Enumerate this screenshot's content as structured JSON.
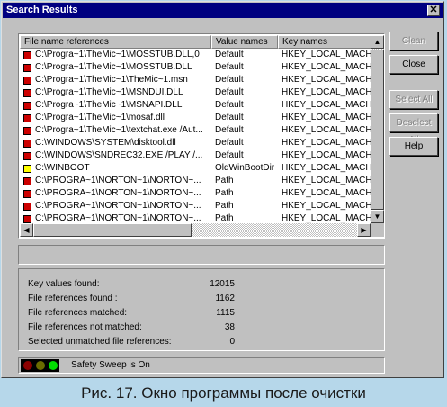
{
  "window": {
    "title": "Search Results",
    "close_glyph": "✕"
  },
  "list": {
    "columns": [
      "File name references",
      "Value names",
      "Key names"
    ],
    "rows": [
      {
        "file": "C:\\Progra~1\\TheMic~1\\MOSSTUB.DLL,0",
        "value": "Default",
        "key": "HKEY_LOCAL_MACHIN",
        "color": "#cc0000"
      },
      {
        "file": "C:\\Progra~1\\TheMic~1\\MOSSTUB.DLL",
        "value": "Default",
        "key": "HKEY_LOCAL_MACHIN",
        "color": "#cc0000"
      },
      {
        "file": "C:\\Progra~1\\TheMic~1\\TheMic~1.msn",
        "value": "Default",
        "key": "HKEY_LOCAL_MACHIN",
        "color": "#cc0000"
      },
      {
        "file": "C:\\Progra~1\\TheMic~1\\MSNDUI.DLL",
        "value": "Default",
        "key": "HKEY_LOCAL_MACHIN",
        "color": "#cc0000"
      },
      {
        "file": "C:\\Progra~1\\TheMic~1\\MSNAPI.DLL",
        "value": "Default",
        "key": "HKEY_LOCAL_MACHIN",
        "color": "#cc0000"
      },
      {
        "file": "C:\\Progra~1\\TheMic~1\\mosaf.dll",
        "value": "Default",
        "key": "HKEY_LOCAL_MACHIN",
        "color": "#cc0000"
      },
      {
        "file": "C:\\Progra~1\\TheMic~1\\textchat.exe /Aut...",
        "value": "Default",
        "key": "HKEY_LOCAL_MACHIN",
        "color": "#cc0000"
      },
      {
        "file": "C:\\WINDOWS\\SYSTEM\\disktool.dll",
        "value": "Default",
        "key": "HKEY_LOCAL_MACHIN",
        "color": "#cc0000"
      },
      {
        "file": "C:\\WINDOWS\\SNDREC32.EXE /PLAY /...",
        "value": "Default",
        "key": "HKEY_LOCAL_MACHIN",
        "color": "#cc0000"
      },
      {
        "file": "C:\\WINBOOT",
        "value": "OldWinBootDir",
        "key": "HKEY_LOCAL_MACHIN",
        "color": "#ffff00"
      },
      {
        "file": "C:\\PROGRA~1\\NORTON~1\\NORTON~...",
        "value": "Path",
        "key": "HKEY_LOCAL_MACHIN",
        "color": "#cc0000"
      },
      {
        "file": "C:\\PROGRA~1\\NORTON~1\\NORTON~...",
        "value": "Path",
        "key": "HKEY_LOCAL_MACHIN",
        "color": "#cc0000"
      },
      {
        "file": "C:\\PROGRA~1\\NORTON~1\\NORTON~...",
        "value": "Path",
        "key": "HKEY_LOCAL_MACHIN",
        "color": "#cc0000"
      },
      {
        "file": "C:\\PROGRA~1\\NORTON~1\\NORTON~...",
        "value": "Path",
        "key": "HKEY_LOCAL_MACHIN",
        "color": "#cc0000"
      }
    ]
  },
  "buttons": {
    "clean": "Clean",
    "close": "Close",
    "select_all": "Select All",
    "deselect_all": "Deselect All",
    "help": "Help"
  },
  "stats": [
    {
      "label": "Key values found:",
      "value": "12015"
    },
    {
      "label": "File references found :",
      "value": "1162"
    },
    {
      "label": "File references matched:",
      "value": "1115"
    },
    {
      "label": "File references not matched:",
      "value": "38"
    },
    {
      "label": "Selected unmatched file references:",
      "value": "0"
    }
  ],
  "status": {
    "text": "Safety Sweep is On",
    "lights": [
      "#8b0000",
      "#6b6b00",
      "#00dd00"
    ]
  },
  "caption": "Рис. 17. Окно программы после очистки"
}
